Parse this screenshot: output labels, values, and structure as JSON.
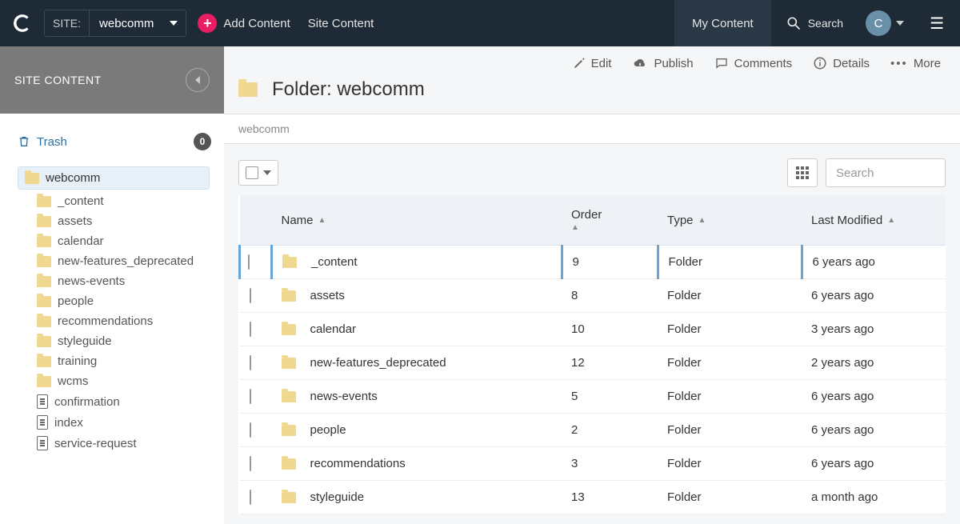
{
  "topbar": {
    "site_label": "SITE:",
    "site_value": "webcomm",
    "add_content": "Add Content",
    "site_content": "Site Content",
    "my_content": "My Content",
    "search": "Search",
    "avatar_initial": "C"
  },
  "sidebar": {
    "title": "SITE CONTENT",
    "trash_label": "Trash",
    "trash_count": "0",
    "root": "webcomm",
    "folders": [
      "_content",
      "assets",
      "calendar",
      "new-features_deprecated",
      "news-events",
      "people",
      "recommendations",
      "styleguide",
      "training",
      "wcms"
    ],
    "files": [
      "confirmation",
      "index",
      "service-request"
    ]
  },
  "actions": {
    "edit": "Edit",
    "publish": "Publish",
    "comments": "Comments",
    "details": "Details",
    "more": "More"
  },
  "page": {
    "title_prefix": "Folder: ",
    "title_name": "webcomm",
    "breadcrumb": "webcomm"
  },
  "table": {
    "search_placeholder": "Search",
    "headers": {
      "name": "Name",
      "order": "Order",
      "type": "Type",
      "last_modified": "Last Modified"
    },
    "rows": [
      {
        "name": "_content",
        "order": "9",
        "type": "Folder",
        "modified": "6 years ago"
      },
      {
        "name": "assets",
        "order": "8",
        "type": "Folder",
        "modified": "6 years ago"
      },
      {
        "name": "calendar",
        "order": "10",
        "type": "Folder",
        "modified": "3 years ago"
      },
      {
        "name": "new-features_deprecated",
        "order": "12",
        "type": "Folder",
        "modified": "2 years ago"
      },
      {
        "name": "news-events",
        "order": "5",
        "type": "Folder",
        "modified": "6 years ago"
      },
      {
        "name": "people",
        "order": "2",
        "type": "Folder",
        "modified": "6 years ago"
      },
      {
        "name": "recommendations",
        "order": "3",
        "type": "Folder",
        "modified": "6 years ago"
      },
      {
        "name": "styleguide",
        "order": "13",
        "type": "Folder",
        "modified": "a month ago"
      }
    ]
  }
}
